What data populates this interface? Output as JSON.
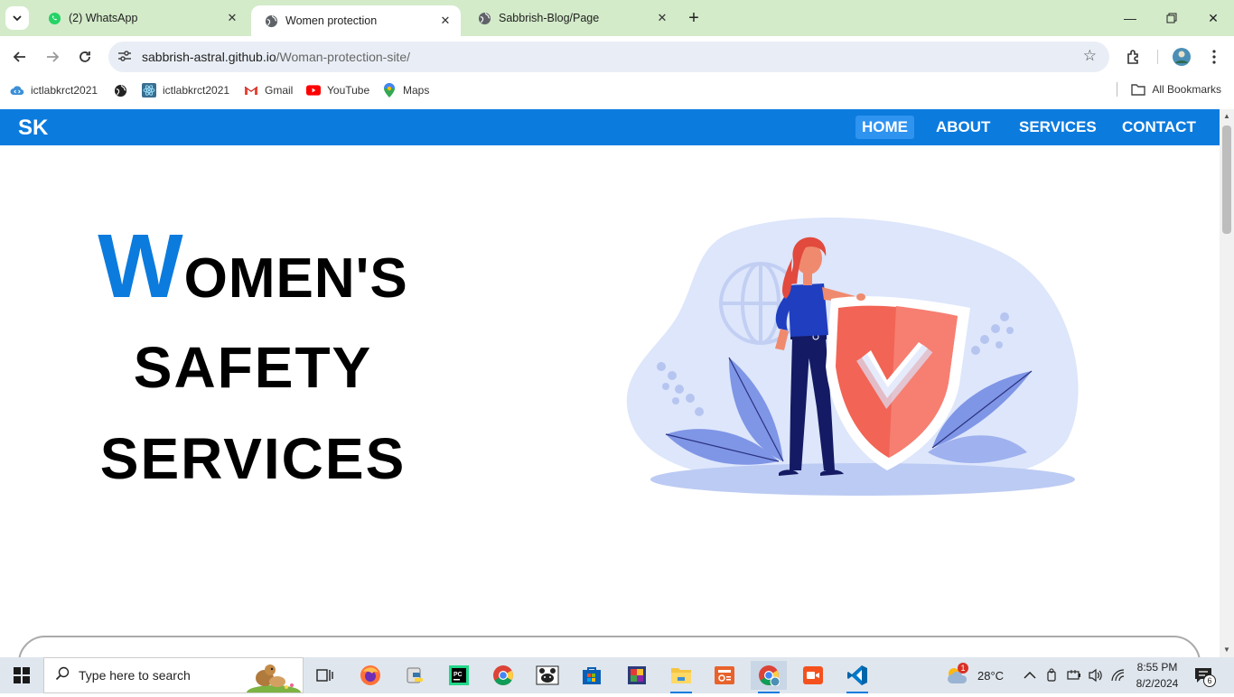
{
  "browser": {
    "tabs": [
      {
        "title": "(2) WhatsApp",
        "icon": "whatsapp-icon",
        "active": false
      },
      {
        "title": "Women protection",
        "icon": "globe-icon",
        "active": true
      },
      {
        "title": "Sabbrish-Blog/Page",
        "icon": "globe-icon",
        "active": false
      }
    ],
    "url_host": "sabbrish-astral.github.io",
    "url_path": "/Woman-protection-site/",
    "bookmarks": [
      {
        "label": "ictlabkrct2021",
        "icon": "code-cloud-icon"
      },
      {
        "label": "",
        "icon": "globe-icon"
      },
      {
        "label": "ictlabkrct2021",
        "icon": "react-icon"
      },
      {
        "label": "Gmail",
        "icon": "gmail-icon"
      },
      {
        "label": "YouTube",
        "icon": "youtube-icon"
      },
      {
        "label": "Maps",
        "icon": "maps-icon"
      }
    ],
    "all_bookmarks": "All Bookmarks"
  },
  "site": {
    "logo": "SK",
    "nav": [
      "HOME",
      "ABOUT",
      "SERVICES",
      "CONTACT"
    ],
    "active_nav": "HOME",
    "hero_initial": "W",
    "hero_line1_rest": "OMEN'S",
    "hero_line2": "SAFETY",
    "hero_line3": "SERVICES",
    "brand_color": "#0c7bde"
  },
  "taskbar": {
    "search_placeholder": "Type here to search",
    "weather": "28°C",
    "weather_badge": "1",
    "time": "8:55 PM",
    "date": "8/2/2024",
    "notifications": "6"
  }
}
